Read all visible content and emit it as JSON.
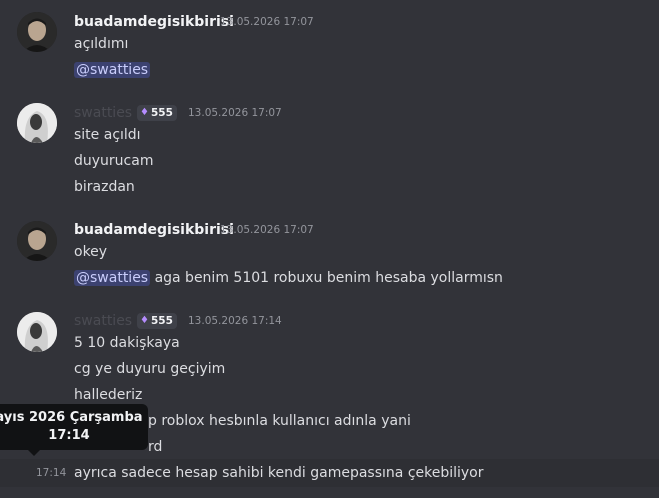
{
  "messages": [
    {
      "author": "buadamdegisikbirisi",
      "timestamp": "13.05.2026 17:07",
      "lines": [
        "açıldımı",
        "@swatties"
      ]
    },
    {
      "author": "swatties",
      "badge": "555",
      "timestamp": "13.05.2026 17:07",
      "lines": [
        "site açıldı",
        "duyurucam",
        "birazdan"
      ]
    },
    {
      "author": "buadamdegisikbirisi",
      "timestamp": "13.05.2026 17:07",
      "lines": [
        "okey",
        "@swatties",
        "aga benim 5101 robuxu benim hesaba yollarmısn"
      ]
    },
    {
      "author": "swatties",
      "badge": "555",
      "timestamp": "13.05.2026 17:14",
      "lines": [
        "5 10 dakişkaya",
        "cg ye duyuru geçiyim",
        "hallederiz",
        "p roblox hesbınla kullanıcı adınla yani",
        "rd",
        "ayrıca sadece hesap sahibi kendi gamepassına çekebiliyor"
      ]
    }
  ],
  "hover": {
    "time": "17:14",
    "tooltip_line1": "ayıs 2026 Çarşamba",
    "tooltip_line2": "17:14"
  },
  "colors": {
    "background": "#323339",
    "mention_bg": "#3c4270",
    "mention_text": "#c9cdfb",
    "badge_flame": "#b58cff"
  }
}
